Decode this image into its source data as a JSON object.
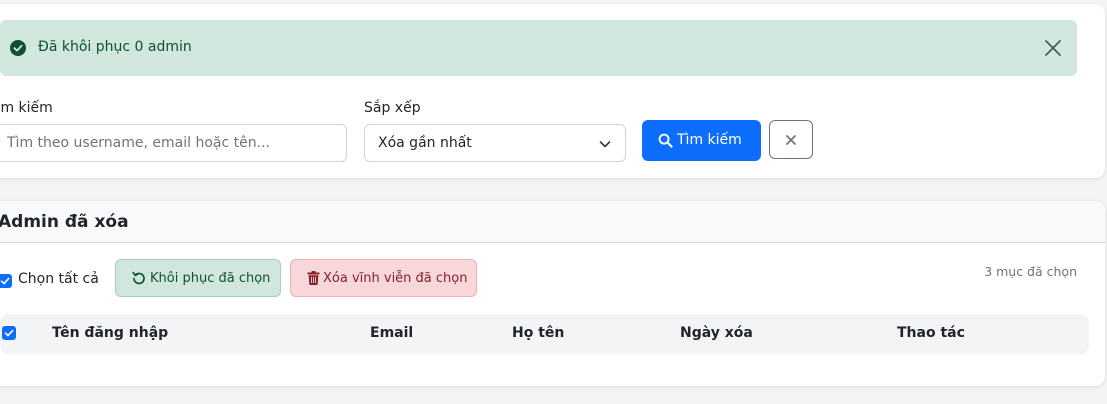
{
  "alert": {
    "message": "Đã khôi phục 0 admin",
    "icon": "check-circle-icon",
    "close_icon": "close-icon"
  },
  "filters": {
    "search_label": "Tìm kiếm",
    "search_placeholder": "Tìm theo username, email hoặc tên...",
    "search_value": "",
    "sort_label": "Sắp xếp",
    "sort_selected": "Xóa gần nhất",
    "search_button": "Tìm kiếm",
    "clear_icon": "close-icon"
  },
  "section": {
    "title": "Admin đã xóa",
    "select_all_label": "Chọn tất cả",
    "restore_button": "Khôi phục đã chọn",
    "delete_button": "Xóa vĩnh viễn đã chọn",
    "selected_count": "3 mục đã chọn"
  },
  "table": {
    "columns": [
      "Tên đăng nhập",
      "Email",
      "Họ tên",
      "Ngày xóa",
      "Thao tác"
    ],
    "rows": []
  },
  "colors": {
    "primary": "#0d6efd",
    "success_bg": "#d1e7dd",
    "success_text": "#0f5132",
    "danger_bg": "#f8d7da",
    "danger_text": "#842029"
  }
}
